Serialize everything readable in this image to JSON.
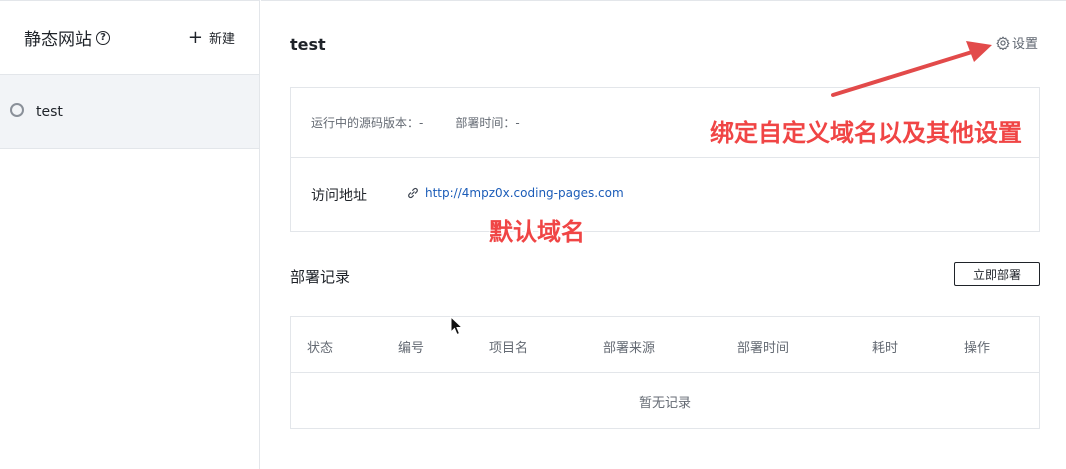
{
  "sidebar": {
    "title": "静态网站",
    "help_icon": "?",
    "new_label": "新建",
    "items": [
      {
        "label": "test",
        "status": "idle"
      }
    ]
  },
  "main": {
    "title": "test",
    "settings_label": "设置",
    "info": {
      "source_version_label": "运行中的源码版本：",
      "source_version_value": "-",
      "deploy_time_label": "部署时间：",
      "deploy_time_value": "-",
      "visit_label": "访问地址",
      "visit_url": "http://4mpz0x.coding-pages.com"
    },
    "records": {
      "title": "部署记录",
      "deploy_now_label": "立即部署",
      "columns": [
        "状态",
        "编号",
        "项目名",
        "部署来源",
        "部署时间",
        "耗时",
        "操作"
      ],
      "empty_text": "暂无记录"
    }
  },
  "annotations": {
    "settings_note": "绑定自定义域名以及其他设置",
    "default_domain_note": "默认域名",
    "color": "#f04545"
  },
  "colors": {
    "link": "#1b5cb8",
    "border": "#e3e6ea",
    "selected_bg": "#f2f4f7"
  }
}
